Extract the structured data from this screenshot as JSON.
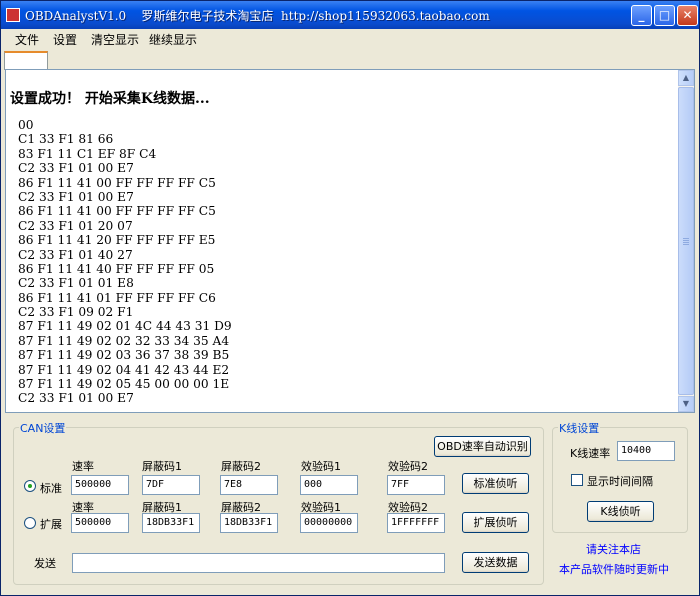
{
  "window": {
    "title": "OBDAnalystV1.0    罗斯维尔电子技术淘宝店  http://shop115932063.taobao.com",
    "buttons": {
      "minimize": "_",
      "maximize": "□",
      "close": "✕"
    }
  },
  "menu": [
    "文件",
    "设置",
    "清空显示",
    "继续显示"
  ],
  "output": {
    "status": "设置成功！ 开始采集K线数据...",
    "lines": [
      "00",
      "C1 33 F1 81 66",
      "83 F1 11 C1 EF 8F C4",
      "C2 33 F1 01 00 E7",
      "86 F1 11 41 00 FF FF FF FF C5",
      "C2 33 F1 01 00 E7",
      "86 F1 11 41 00 FF FF FF FF C5",
      "C2 33 F1 01 20 07",
      "86 F1 11 41 20 FF FF FF FF E5",
      "C2 33 F1 01 40 27",
      "86 F1 11 41 40 FF FF FF FF 05",
      "C2 33 F1 01 01 E8",
      "86 F1 11 41 01 FF FF FF FF C6",
      "C2 33 F1 09 02 F1",
      "87 F1 11 49 02 01 4C 44 43 31 D9",
      "87 F1 11 49 02 02 32 33 34 35 A4",
      "87 F1 11 49 02 03 36 37 38 39 B5",
      "87 F1 11 49 02 04 41 42 43 44 E2",
      "87 F1 11 49 02 05 45 00 00 00 1E",
      "C2 33 F1 01 00 E7"
    ]
  },
  "can": {
    "legend": "CAN设置",
    "auto_detect_button": "OBD速率自动识别",
    "standard": {
      "radio_label": "标准",
      "selected": true,
      "headers": [
        "速率",
        "屏蔽码1",
        "屏蔽码2",
        "效验码1",
        "效验码2"
      ],
      "values": [
        "500000",
        "7DF",
        "7E8",
        "000",
        "7FF"
      ],
      "listen_button": "标准侦听"
    },
    "extended": {
      "radio_label": "扩展",
      "selected": false,
      "headers": [
        "速率",
        "屏蔽码1",
        "屏蔽码2",
        "效验码1",
        "效验码2"
      ],
      "values": [
        "500000",
        "18DB33F1",
        "18DB33F1",
        "00000000",
        "1FFFFFFF"
      ],
      "listen_button": "扩展侦听"
    },
    "send_label": "发送",
    "send_value": "",
    "send_button": "发送数据"
  },
  "kline": {
    "legend": "K线设置",
    "rate_label": "K线速率",
    "rate_value": "10400",
    "show_interval_label": "显示时间间隔",
    "show_interval_checked": false,
    "listen_button": "K线侦听"
  },
  "notice": {
    "line1": "请关注本店",
    "line2": "本产品软件随时更新中"
  }
}
